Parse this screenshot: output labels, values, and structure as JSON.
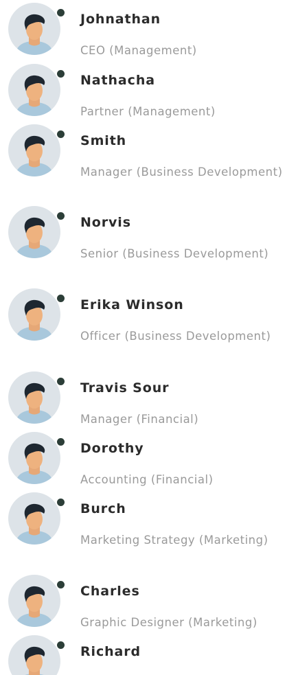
{
  "contacts": [
    {
      "name": "Johnathan",
      "role": "CEO (Management)",
      "online": true
    },
    {
      "name": "Nathacha",
      "role": "Partner (Management)",
      "online": true
    },
    {
      "name": "Smith",
      "role": "Manager (Business Development)",
      "online": true
    },
    {
      "name": "Norvis",
      "role": "Senior (Business Development)",
      "online": true
    },
    {
      "name": "Erika Winson",
      "role": "Officer (Business Development)",
      "online": true
    },
    {
      "name": "Travis Sour",
      "role": "Manager (Financial)",
      "online": true
    },
    {
      "name": "Dorothy",
      "role": "Accounting (Financial)",
      "online": true
    },
    {
      "name": "Burch",
      "role": "Marketing Strategy (Marketing)",
      "online": true
    },
    {
      "name": "Charles",
      "role": "Graphic Designer (Marketing)",
      "online": true
    },
    {
      "name": "Richard",
      "role": "",
      "online": true
    }
  ],
  "colors": {
    "avatar_bg": "#dde3e8",
    "status_online": "#2c3e38",
    "name_text": "#2b2b2b",
    "role_text": "#9a9a9a"
  },
  "icons": {
    "avatar": "person-avatar-icon",
    "status": "online-status-dot"
  }
}
